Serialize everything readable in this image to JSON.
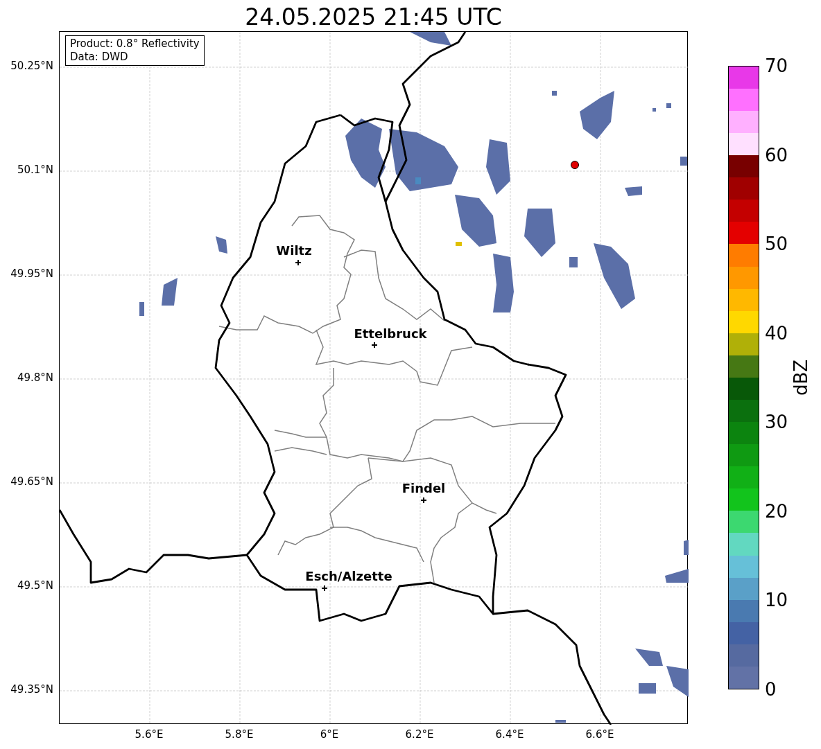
{
  "title": "24.05.2025 21:45 UTC",
  "info_box": [
    "Product: 0.8° Reflectivity",
    "Data: DWD"
  ],
  "cities": [
    {
      "name": "Wiltz"
    },
    {
      "name": "Ettelbruck"
    },
    {
      "name": "Findel"
    },
    {
      "name": "Esch/Alzette"
    }
  ],
  "lat_ticks": [
    "50.25°N",
    "50.1°N",
    "49.95°N",
    "49.8°N",
    "49.65°N",
    "49.5°N",
    "49.35°N"
  ],
  "lon_ticks": [
    "5.6°E",
    "5.8°E",
    "6°E",
    "6.2°E",
    "6.4°E",
    "6.6°E"
  ],
  "colorbar": {
    "label": "dBZ",
    "ticks": [
      "70",
      "60",
      "50",
      "40",
      "30",
      "20",
      "10",
      "0"
    ],
    "bands": [
      {
        "color": "#6272a6"
      },
      {
        "color": "#566aa0"
      },
      {
        "color": "#4462a4"
      },
      {
        "color": "#4a7ab0"
      },
      {
        "color": "#5aa0c8"
      },
      {
        "color": "#66c0d8"
      },
      {
        "color": "#62d8c0"
      },
      {
        "color": "#3cd870"
      },
      {
        "color": "#12c41c"
      },
      {
        "color": "#11b016"
      },
      {
        "color": "#0f9a12"
      },
      {
        "color": "#0c840f"
      },
      {
        "color": "#0b700e"
      },
      {
        "color": "#085808"
      },
      {
        "color": "#467814"
      },
      {
        "color": "#b0b008"
      },
      {
        "color": "#ffd800"
      },
      {
        "color": "#ffb800"
      },
      {
        "color": "#ff9800"
      },
      {
        "color": "#ff7c00"
      },
      {
        "color": "#e40000"
      },
      {
        "color": "#c40000"
      },
      {
        "color": "#a00000"
      },
      {
        "color": "#780000"
      },
      {
        "color": "#ffe0ff"
      },
      {
        "color": "#ffb0ff"
      },
      {
        "color": "#ff70ff"
      },
      {
        "color": "#e838e8"
      }
    ]
  }
}
